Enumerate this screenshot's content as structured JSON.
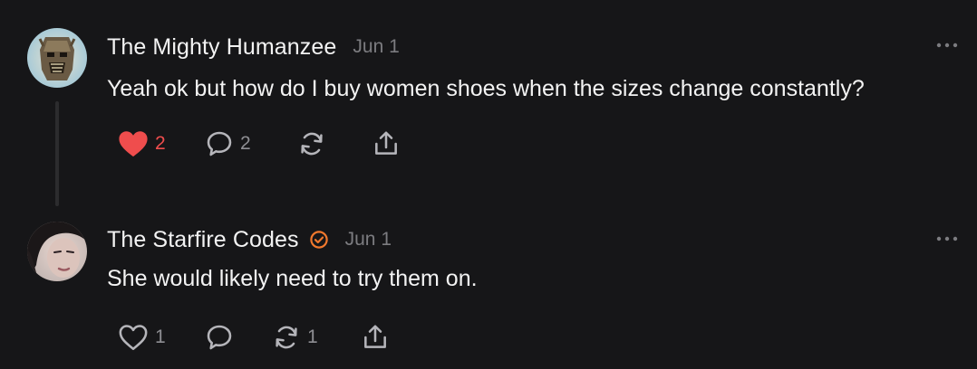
{
  "posts": [
    {
      "author": "The Mighty Humanzee",
      "date": "Jun 1",
      "text": "Yeah ok but how do I buy women shoes when the sizes change constantly?",
      "verified": false,
      "actions": {
        "like_count": "2",
        "liked": true,
        "comment_count": "2",
        "restack_count": "",
        "like_icon": "heart-filled-icon",
        "comment_icon": "comment-bubble-icon",
        "restack_icon": "restack-icon",
        "share_icon": "share-icon"
      }
    },
    {
      "author": "The Starfire Codes",
      "date": "Jun 1",
      "text": "She would likely need to try them on.",
      "verified": true,
      "actions": {
        "like_count": "1",
        "liked": false,
        "comment_count": "",
        "restack_count": "1",
        "like_icon": "heart-outline-icon",
        "comment_icon": "comment-bubble-icon",
        "restack_icon": "restack-icon",
        "share_icon": "share-icon"
      }
    }
  ],
  "colors": {
    "background": "#161618",
    "liked": "#ef4d4d",
    "verified_badge": "#f0782d",
    "muted": "#8e8e93"
  }
}
